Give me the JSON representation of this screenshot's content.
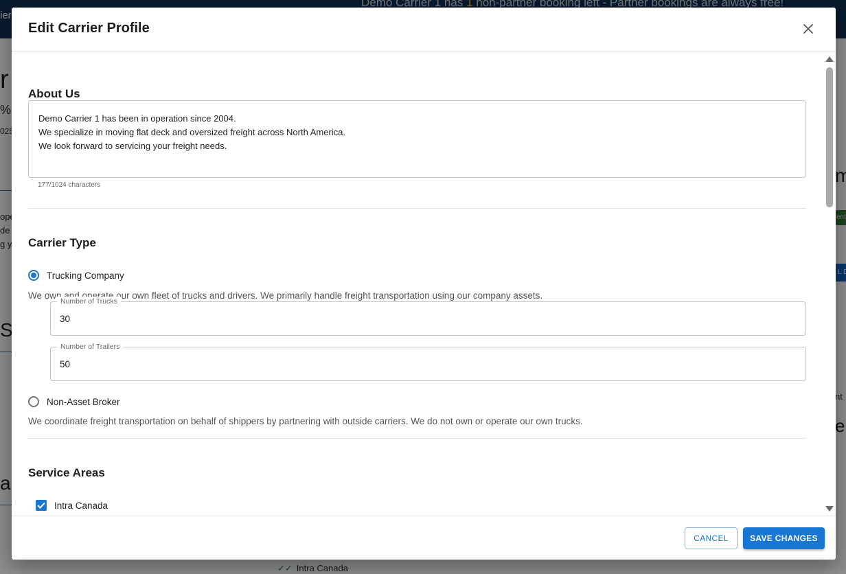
{
  "background": {
    "topbar_fragment": "ier",
    "banner": {
      "prefix": "Demo Carrier 1 has ",
      "count": "1",
      "suffix": " non-partner booking left - Partner bookings are always free!"
    },
    "fragments": {
      "r": "r",
      "percent": "%",
      "year": "025",
      "ope": "ope",
      "de": "de",
      "gy": "g y",
      "st": "St",
      "a": "a",
      "m": "m",
      "nt": "nt",
      "er": "er"
    },
    "badge_text": "ent",
    "button_text": "L Di",
    "peek_checkbox_label": "Intra Canada"
  },
  "dialog": {
    "title": "Edit Carrier Profile",
    "close_icon": "close-icon",
    "about": {
      "title": "About Us",
      "text": "Demo Carrier 1 has been in operation since 2004.\nWe specialize in moving flat deck and oversized freight across North America.\nWe look forward to servicing your freight needs.",
      "char_count": "177/1024 characters"
    },
    "carrier_type": {
      "title": "Carrier Type",
      "options": [
        {
          "label": "Trucking Company",
          "description": "We own and operate our own fleet of trucks and drivers. We primarily handle freight transportation using our company assets.",
          "selected": true
        },
        {
          "label": "Non-Asset Broker",
          "description": "We coordinate freight transportation on behalf of shippers by partnering with outside carriers. We do not own or operate our own trucks.",
          "selected": false
        }
      ],
      "fields": {
        "trucks": {
          "label": "Number of Trucks",
          "value": "30"
        },
        "trailers": {
          "label": "Number of Trailers",
          "value": "50"
        }
      }
    },
    "service_areas": {
      "title": "Service Areas",
      "items": [
        {
          "label": "Intra Canada",
          "checked": true
        }
      ]
    },
    "footer": {
      "cancel_label": "CANCEL",
      "save_label": "SAVE CHANGES"
    }
  },
  "colors": {
    "primary": "#1976d2",
    "topbar": "#0f3152",
    "banner_highlight": "#f2c230"
  }
}
